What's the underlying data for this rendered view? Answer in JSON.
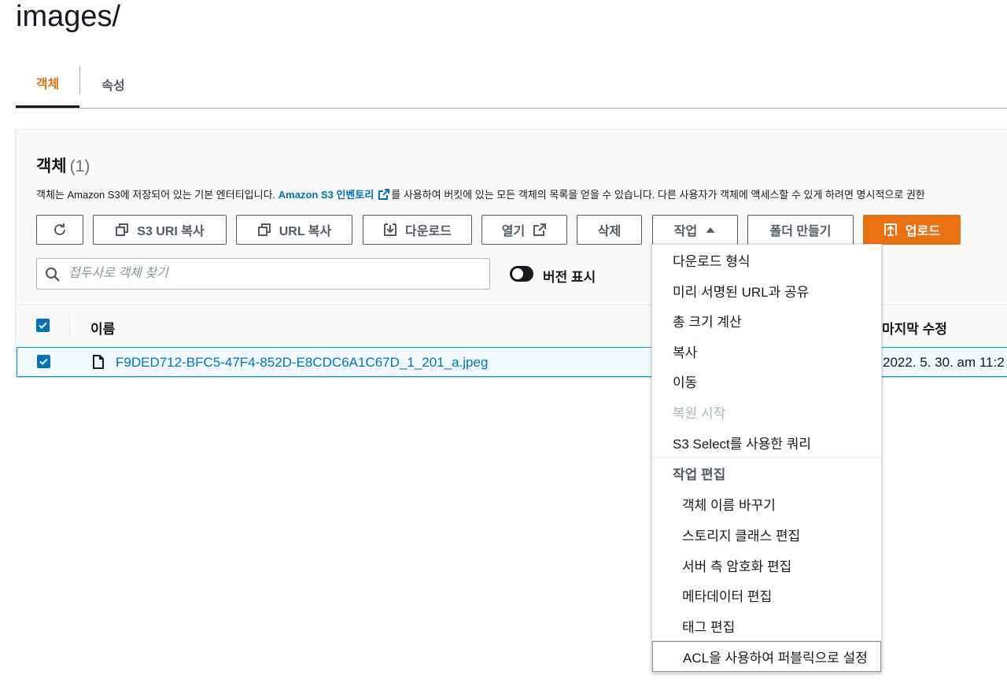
{
  "page": {
    "title": "images/"
  },
  "tabs": [
    {
      "label": "객체",
      "active": true
    },
    {
      "label": "속성",
      "active": false
    }
  ],
  "objects": {
    "title": "객체",
    "count": "(1)",
    "desc_before": "객체는 Amazon S3에 저장되어 있는 기본 엔터티입니다. ",
    "desc_link": "Amazon S3 인벤토리",
    "desc_after": "를 사용하여 버킷에 있는 모든 객체의 목록을 얻을 수 있습니다. 다른 사용자가 객체에 액세스할 수 있게 하려면 명시적으로 권한",
    "toolbar": {
      "copy_s3_uri": "S3 URI 복사",
      "copy_url": "URL 복사",
      "download": "다운로드",
      "open": "열기",
      "delete": "삭제",
      "actions": "작업",
      "create_folder": "폴더 만들기",
      "upload": "업로드"
    },
    "search": {
      "placeholder": "접두사로 객체 찾기",
      "value": ""
    },
    "versions_toggle": {
      "label": "버전 표시",
      "on": false
    },
    "columns": {
      "name": "이름",
      "last_modified": "마지막 수정"
    },
    "rows": [
      {
        "name": "F9DED712-BFC5-47F4-852D-E8CDC6A1C67D_1_201_a.jpeg",
        "last_modified": "2022. 5. 30. am 11:2",
        "selected": true
      }
    ]
  },
  "actions_menu": {
    "items": [
      {
        "label": "다운로드 형식"
      },
      {
        "label": "미리 서명된 URL과 공유"
      },
      {
        "label": "총 크기 계산"
      },
      {
        "label": "복사"
      },
      {
        "label": "이동"
      },
      {
        "label": "복원 시작",
        "disabled": true
      },
      {
        "label": "S3 Select를 사용한 쿼리"
      }
    ],
    "edit_group": {
      "label": "작업 편집",
      "items": [
        {
          "label": "객체 이름 바꾸기"
        },
        {
          "label": "스토리지 클래스 편집"
        },
        {
          "label": "서버 측 암호화 편집"
        },
        {
          "label": "메타데이터 편집"
        },
        {
          "label": "태그 편집"
        },
        {
          "label": "ACL을 사용하여 퍼블릭으로 설정",
          "focused": true
        }
      ]
    }
  },
  "colors": {
    "accent": "#ec7211",
    "link": "#0073bb",
    "selected_border": "#00a1c9"
  }
}
